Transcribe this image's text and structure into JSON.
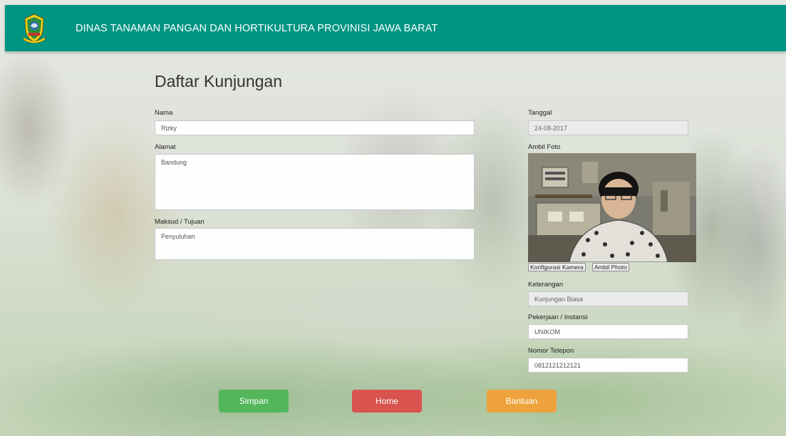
{
  "header": {
    "title": "DINAS TANAMAN PANGAN DAN HORTIKULTURA PROVINISI JAWA BARAT",
    "color": "#009483",
    "logo_icon": "jawa-barat-emblem-icon"
  },
  "form": {
    "title": "Daftar Kunjungan",
    "nama": {
      "label": "Nama",
      "value": "Rizky"
    },
    "alamat": {
      "label": "Alamat",
      "value": "Bandung"
    },
    "maksud": {
      "label": "Maksud / Tujuan",
      "value": "Penyuluhan"
    },
    "tanggal": {
      "label": "Tanggal",
      "value": "24-08-2017"
    },
    "foto": {
      "label": "Ambil Foto",
      "configure_label": "Konfigurasi Kamera",
      "capture_label": "Ambil Photo"
    },
    "keterangan": {
      "label": "Keterangan",
      "value": "Kunjungan Biasa"
    },
    "pekerjaan": {
      "label": "Pekerjaan / Instansi",
      "value": "UNIKOM"
    },
    "telepon": {
      "label": "Nomor Telepon",
      "value": "0812121212121"
    }
  },
  "buttons": {
    "save": {
      "label": "Simpan",
      "color": "#53b65a"
    },
    "home": {
      "label": "Home",
      "color": "#d9534f"
    },
    "help": {
      "label": "Bantuan",
      "color": "#eea23c"
    }
  }
}
